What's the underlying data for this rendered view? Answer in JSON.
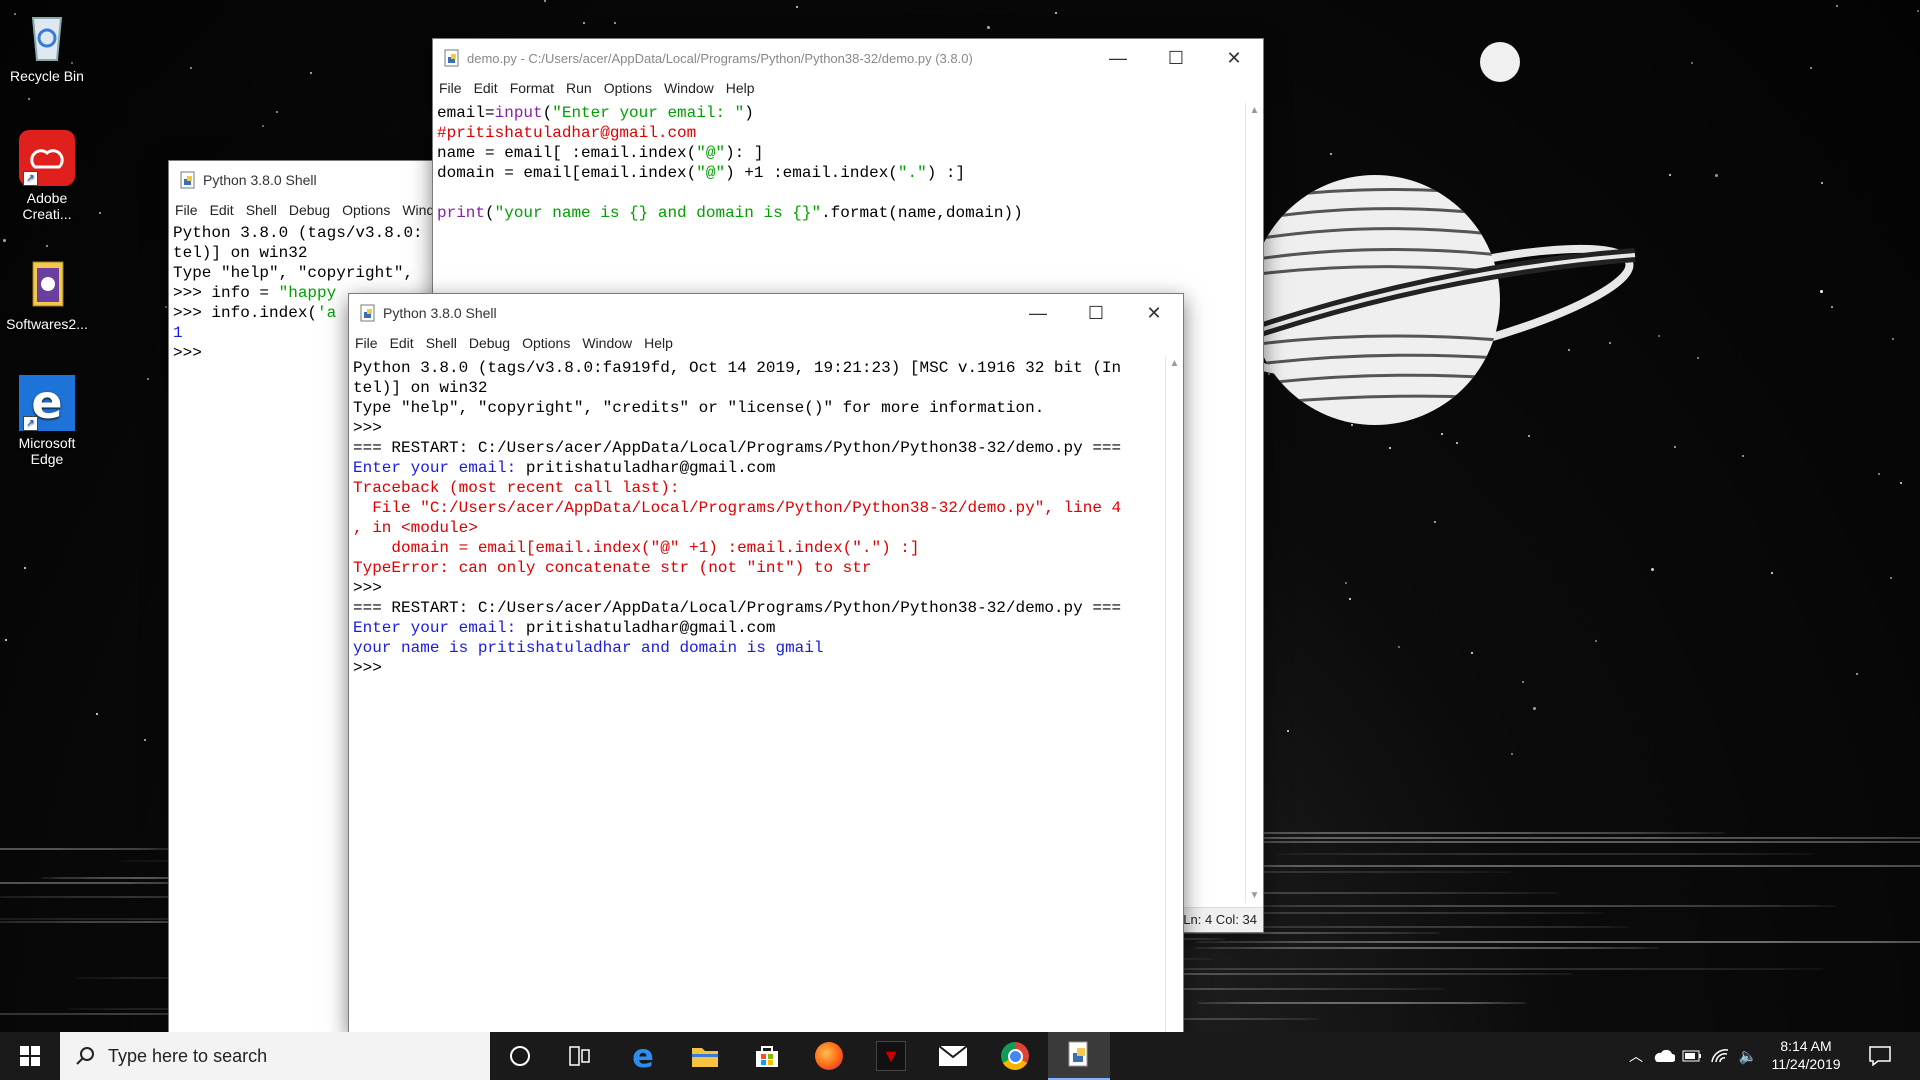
{
  "desktop_icons": [
    {
      "label": "Recycle Bin"
    },
    {
      "label": "Adobe Creati..."
    },
    {
      "label": "Softwares2..."
    },
    {
      "label": "Microsoft Edge"
    }
  ],
  "editor": {
    "title": "demo.py - C:/Users/acer/AppData/Local/Programs/Python/Python38-32/demo.py (3.8.0)",
    "menu": [
      "File",
      "Edit",
      "Format",
      "Run",
      "Options",
      "Window",
      "Help"
    ],
    "lines": [
      [
        {
          "t": "email=",
          "c": "black"
        },
        {
          "t": "input",
          "c": "purple"
        },
        {
          "t": "(",
          "c": "black"
        },
        {
          "t": "\"Enter your email: \"",
          "c": "green"
        },
        {
          "t": ")",
          "c": "black"
        }
      ],
      [
        {
          "t": "#pritishatuladhar@gmail.com",
          "c": "red"
        }
      ],
      [
        {
          "t": "name = email[ :email.index(",
          "c": "black"
        },
        {
          "t": "\"@\"",
          "c": "green"
        },
        {
          "t": "): ]",
          "c": "black"
        }
      ],
      [
        {
          "t": "domain = email[email.index(",
          "c": "black"
        },
        {
          "t": "\"@\"",
          "c": "green"
        },
        {
          "t": ") +1 :email.index(",
          "c": "black"
        },
        {
          "t": "\".\"",
          "c": "green"
        },
        {
          "t": ") :]",
          "c": "black"
        }
      ],
      [
        {
          "t": "",
          "c": "black"
        }
      ],
      [
        {
          "t": "print",
          "c": "purple"
        },
        {
          "t": "(",
          "c": "black"
        },
        {
          "t": "\"your name is {} and domain is {}\"",
          "c": "green"
        },
        {
          "t": ".format(name,domain))",
          "c": "black"
        }
      ]
    ],
    "status": "Ln: 4  Col: 34"
  },
  "back_shell": {
    "title": "Python 3.8.0 Shell",
    "menu": [
      "File",
      "Edit",
      "Shell",
      "Debug",
      "Options",
      "Window"
    ],
    "lines": [
      [
        {
          "t": "Python 3.8.0 (tags/v3.8.0:",
          "c": "black"
        }
      ],
      [
        {
          "t": "tel)] on win32",
          "c": "black"
        }
      ],
      [
        {
          "t": "Type \"help\", \"copyright\",",
          "c": "black"
        }
      ],
      [
        {
          "t": ">>> info = ",
          "c": "black"
        },
        {
          "t": "\"happy",
          "c": "green"
        }
      ],
      [
        {
          "t": ">>> info.index(",
          "c": "black"
        },
        {
          "t": "'a",
          "c": "green"
        }
      ],
      [
        {
          "t": "1",
          "c": "blue"
        }
      ],
      [
        {
          "t": ">>>",
          "c": "black"
        }
      ]
    ]
  },
  "front_shell": {
    "title": "Python 3.8.0 Shell",
    "menu": [
      "File",
      "Edit",
      "Shell",
      "Debug",
      "Options",
      "Window",
      "Help"
    ],
    "lines": [
      [
        {
          "t": "Python 3.8.0 (tags/v3.8.0:fa919fd, Oct 14 2019, 19:21:23) [MSC v.1916 32 bit (In",
          "c": "black"
        }
      ],
      [
        {
          "t": "tel)] on win32",
          "c": "black"
        }
      ],
      [
        {
          "t": "Type \"help\", \"copyright\", \"credits\" or \"license()\" for more information.",
          "c": "black"
        }
      ],
      [
        {
          "t": ">>>",
          "c": "black"
        }
      ],
      [
        {
          "t": "=== RESTART: C:/Users/acer/AppData/Local/Programs/Python/Python38-32/demo.py ===",
          "c": "black"
        }
      ],
      [
        {
          "t": "Enter your email: ",
          "c": "blue"
        },
        {
          "t": "pritishatuladhar@gmail.com",
          "c": "black"
        }
      ],
      [
        {
          "t": "Traceback (most recent call last):",
          "c": "red"
        }
      ],
      [
        {
          "t": "  File \"C:/Users/acer/AppData/Local/Programs/Python/Python38-32/demo.py\", line 4",
          "c": "red"
        }
      ],
      [
        {
          "t": ", in <module>",
          "c": "red"
        }
      ],
      [
        {
          "t": "    domain = email[email.index(\"@\" +1) :email.index(\".\") :]",
          "c": "red"
        }
      ],
      [
        {
          "t": "TypeError: can only concatenate str (not \"int\") to str",
          "c": "red"
        }
      ],
      [
        {
          "t": ">>>",
          "c": "black"
        }
      ],
      [
        {
          "t": "=== RESTART: C:/Users/acer/AppData/Local/Programs/Python/Python38-32/demo.py ===",
          "c": "black"
        }
      ],
      [
        {
          "t": "Enter your email: ",
          "c": "blue"
        },
        {
          "t": "pritishatuladhar@gmail.com",
          "c": "black"
        }
      ],
      [
        {
          "t": "your name is pritishatuladhar and domain is gmail",
          "c": "blue"
        }
      ],
      [
        {
          "t": ">>>",
          "c": "black"
        }
      ]
    ]
  },
  "taskbar": {
    "search_placeholder": "Type here to search",
    "time": "8:14 AM",
    "date": "11/24/2019",
    "apps": [
      "cortana-icon",
      "task-view-icon",
      "edge-icon",
      "file-explorer-icon",
      "store-icon",
      "firefox-icon",
      "predator-icon",
      "mail-icon",
      "chrome-icon",
      "idle-icon"
    ]
  },
  "colors": {
    "black": "#000000",
    "blue": "#1b1be0",
    "red": "#e00000",
    "green": "#00a000",
    "purple": "#8b1ea8",
    "taskbar": "#1a1a1a"
  }
}
